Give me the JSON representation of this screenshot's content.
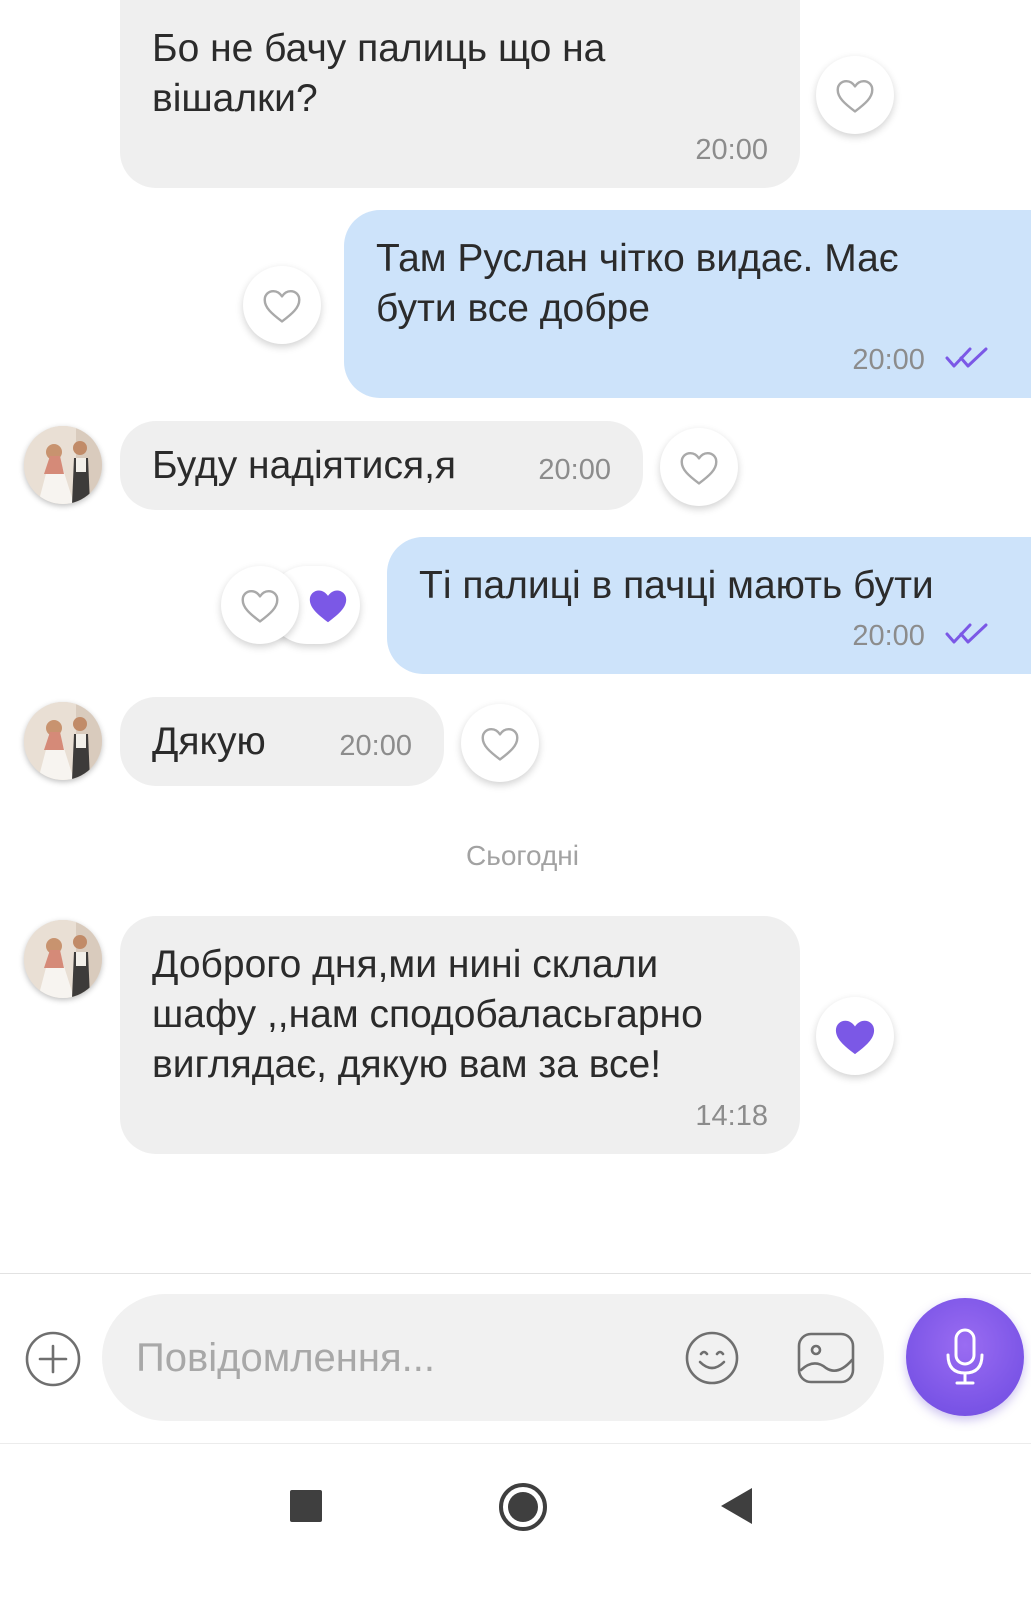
{
  "colors": {
    "incoming_bubble": "#efefef",
    "outgoing_bubble": "#cde3fa",
    "accent": "#7b58e6",
    "timestamp": "#8c8c8c"
  },
  "messages": [
    {
      "direction": "incoming",
      "text": "Бо не бачу палиць що на\nвішалки?",
      "time": "20:00",
      "reaction": "heart-outline"
    },
    {
      "direction": "outgoing",
      "text": "Там Руслан чітко видає. Має\nбути все добре",
      "time": "20:00",
      "status": "read",
      "reaction": "heart-outline"
    },
    {
      "direction": "incoming",
      "text": "Буду надіятися,я",
      "time": "20:00",
      "reaction": "heart-outline"
    },
    {
      "direction": "outgoing",
      "text": "Ті палиці в пачці мають бути",
      "time": "20:00",
      "status": "read",
      "reaction": "heart-filled"
    },
    {
      "direction": "incoming",
      "text": "Дякую",
      "time": "20:00",
      "reaction": "heart-outline"
    },
    {
      "direction": "incoming",
      "text": "Доброго дня,ми нині склали\nшафу ,,нам сподобаласьгарно\nвиглядає, дякую вам за все!",
      "time": "14:18",
      "reaction": "heart-filled"
    }
  ],
  "date_separator": "Сьогодні",
  "composer": {
    "placeholder": "Повідомлення...",
    "icons": [
      "plus-icon",
      "emoji-icon",
      "sticker-icon",
      "microphone-icon"
    ]
  },
  "navigation": {
    "icons": [
      "recent-apps-icon",
      "home-icon",
      "back-icon"
    ]
  }
}
